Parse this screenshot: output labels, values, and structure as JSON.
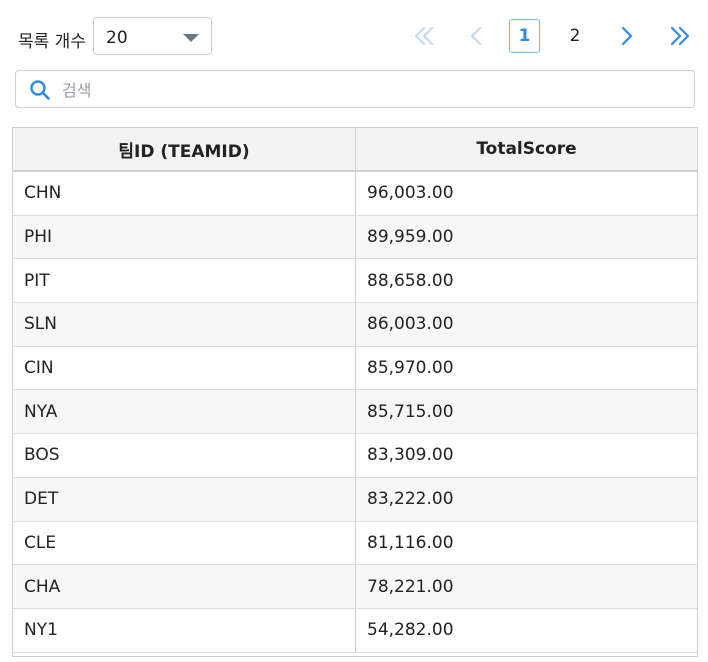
{
  "pagesize": {
    "label": "목록 개수",
    "value": "20"
  },
  "pagination": {
    "pages": [
      "1",
      "2"
    ],
    "current": "1"
  },
  "search": {
    "placeholder": "검색",
    "value": ""
  },
  "table": {
    "columns": [
      "팀ID (TEAMID)",
      "TotalScore"
    ],
    "rows": [
      [
        "CHN",
        "96,003.00"
      ],
      [
        "PHI",
        "89,959.00"
      ],
      [
        "PIT",
        "88,658.00"
      ],
      [
        "SLN",
        "86,003.00"
      ],
      [
        "CIN",
        "85,970.00"
      ],
      [
        "NYA",
        "85,715.00"
      ],
      [
        "BOS",
        "83,309.00"
      ],
      [
        "DET",
        "83,222.00"
      ],
      [
        "CLE",
        "81,116.00"
      ],
      [
        "CHA",
        "78,221.00"
      ],
      [
        "NY1",
        "54,282.00"
      ]
    ]
  },
  "icons": {
    "first": "double-chevron-left-icon",
    "prev": "chevron-left-icon",
    "next": "chevron-right-icon",
    "last": "double-chevron-right-icon",
    "search": "search-icon",
    "dropdown": "caret-down-icon"
  },
  "colors": {
    "accent": "#2f8ae2",
    "disabled": "#c7d9ee",
    "header_bg": "#f3f3f3"
  }
}
